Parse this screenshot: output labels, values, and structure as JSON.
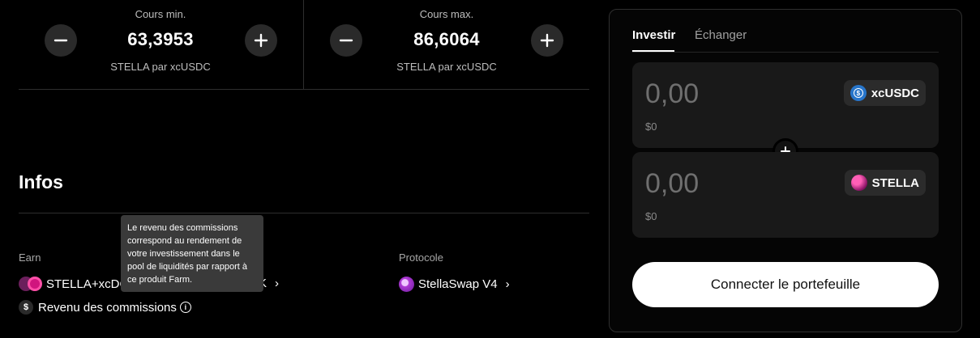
{
  "range": {
    "min": {
      "label": "Cours min.",
      "value": "63,3953",
      "unit": "STELLA par xcUSDC"
    },
    "max": {
      "label": "Cours max.",
      "value": "86,6064",
      "unit": "STELLA par xcUSDC"
    }
  },
  "infos": {
    "title": "Infos",
    "earn": {
      "label": "Earn",
      "farm_name": "STELLA+xcDC",
      "farm_suffix": "K"
    },
    "protocol": {
      "label": "Protocole",
      "name": "StellaSwap V4"
    },
    "commission": {
      "label": "Revenu des commissions"
    },
    "tooltip": "Le revenu des commissions correspond au rendement de votre investissement dans le pool de liquidités par rapport à ce produit Farm."
  },
  "panel": {
    "tabs": [
      {
        "label": "Investir",
        "active": true
      },
      {
        "label": "Échanger",
        "active": false
      }
    ],
    "token_a": {
      "amount": "0,00",
      "usd": "$0",
      "symbol": "xcUSDC",
      "icon": "usdc-icon"
    },
    "token_b": {
      "amount": "0,00",
      "usd": "$0",
      "symbol": "STELLA",
      "icon": "stella-icon"
    },
    "connect_label": "Connecter le portefeuille"
  },
  "colors": {
    "background": "#000000",
    "accent_usdc": "#2775ca",
    "accent_stella": "#c2188b"
  }
}
